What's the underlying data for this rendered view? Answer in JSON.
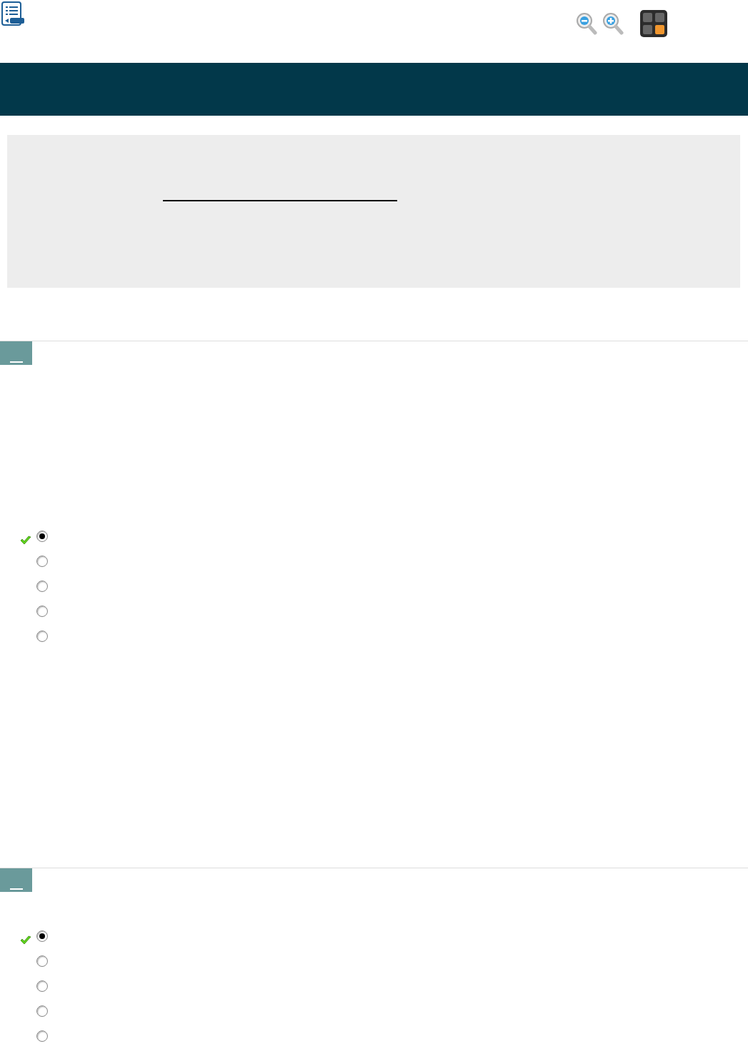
{
  "questions": [
    {
      "options": [
        {
          "selected": true,
          "correct": true
        },
        {
          "selected": false,
          "correct": false
        },
        {
          "selected": false,
          "correct": false
        },
        {
          "selected": false,
          "correct": false
        },
        {
          "selected": false,
          "correct": false
        }
      ]
    },
    {
      "options": [
        {
          "selected": true,
          "correct": true
        },
        {
          "selected": false,
          "correct": false
        },
        {
          "selected": false,
          "correct": false
        },
        {
          "selected": false,
          "correct": false
        },
        {
          "selected": false,
          "correct": false
        }
      ]
    }
  ]
}
